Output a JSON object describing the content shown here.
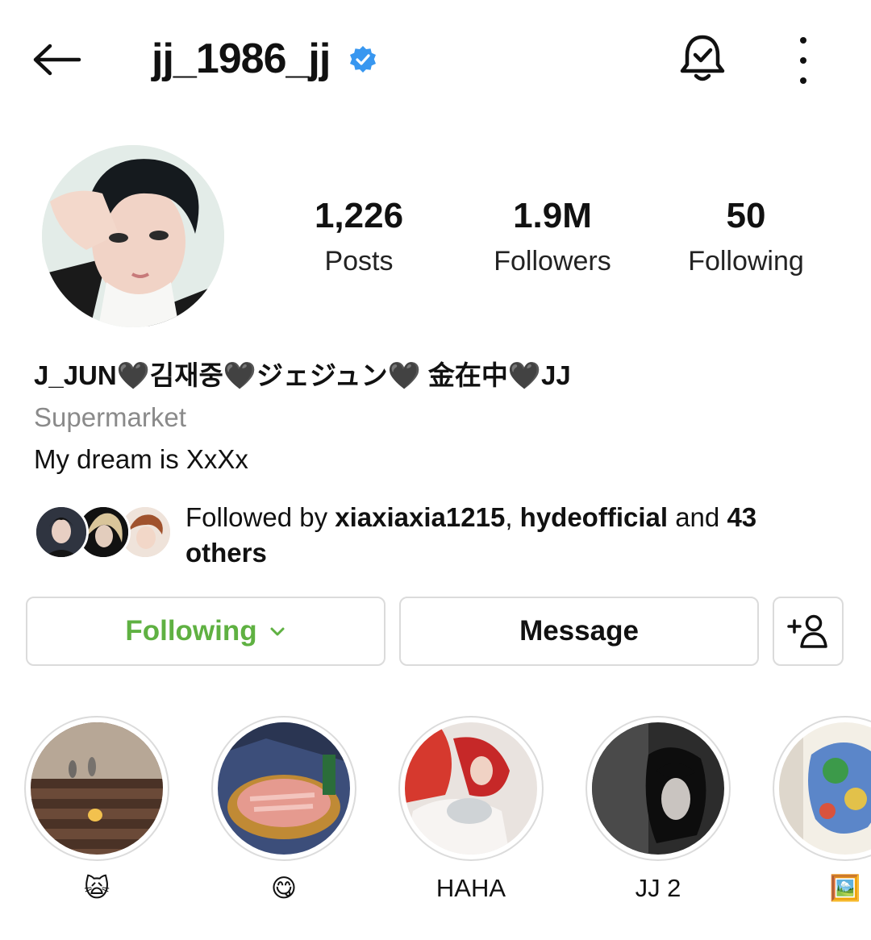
{
  "header": {
    "username": "jj_1986_jj"
  },
  "stats": {
    "posts_value": "1,226",
    "posts_label": "Posts",
    "followers_value": "1.9M",
    "followers_label": "Followers",
    "following_value": "50",
    "following_label": "Following"
  },
  "bio": {
    "display_name": "J_JUN🖤김재중🖤ジェジュン🖤 金在中🖤JJ",
    "category": "Supermarket",
    "text": "My dream is XxXx"
  },
  "followed_by": {
    "prefix": "Followed by ",
    "user1": "xiaxiaxia1215",
    "separator": ", ",
    "user2": "hydeofficial",
    "and_text": " and ",
    "count": "43 others"
  },
  "actions": {
    "following_label": "Following",
    "message_label": "Message"
  },
  "highlights": [
    {
      "caption": "🙀"
    },
    {
      "caption": "😋"
    },
    {
      "caption": "HAHA"
    },
    {
      "caption": "JJ 2"
    },
    {
      "caption": "🖼️"
    }
  ],
  "colors": {
    "verified_blue": "#3897f0",
    "following_green": "#5fb142",
    "border_gray": "#dbdbdb",
    "muted_text": "#8a8a8a"
  }
}
